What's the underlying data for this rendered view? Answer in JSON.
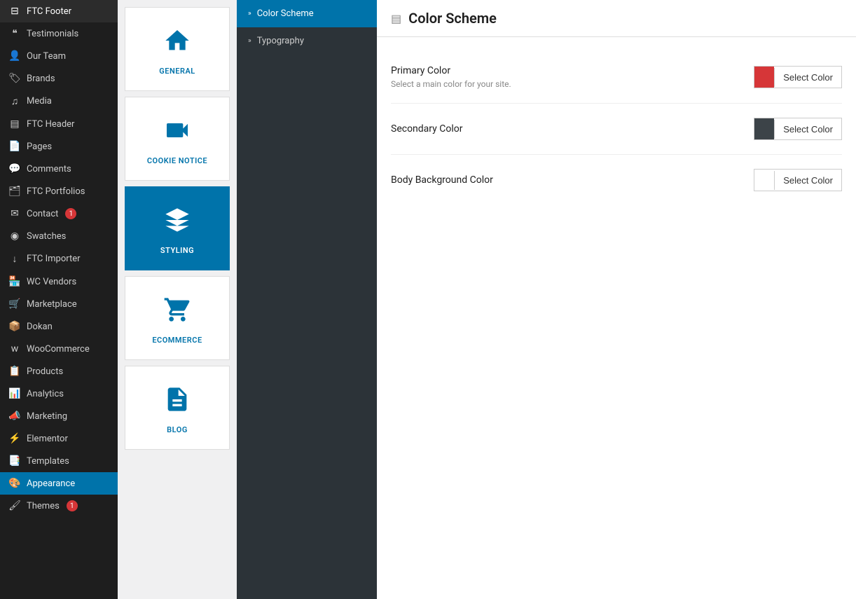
{
  "sidebar": {
    "items": [
      {
        "id": "ftc-footer",
        "label": "FTC Footer",
        "icon": "🔻",
        "active": false
      },
      {
        "id": "testimonials",
        "label": "Testimonials",
        "icon": "💬",
        "active": false
      },
      {
        "id": "our-team",
        "label": "Our Team",
        "icon": "👥",
        "active": false
      },
      {
        "id": "brands",
        "label": "Brands",
        "icon": "🏷",
        "active": false
      },
      {
        "id": "media",
        "label": "Media",
        "icon": "🎵",
        "active": false
      },
      {
        "id": "ftc-header",
        "label": "FTC Header",
        "icon": "📄",
        "active": false
      },
      {
        "id": "pages",
        "label": "Pages",
        "icon": "📃",
        "active": false
      },
      {
        "id": "comments",
        "label": "Comments",
        "icon": "💭",
        "active": false,
        "badge": null
      },
      {
        "id": "ftc-portfolios",
        "label": "FTC Portfolios",
        "icon": "🖼",
        "active": false
      },
      {
        "id": "contact",
        "label": "Contact",
        "icon": "✉",
        "active": false,
        "badge": "1"
      },
      {
        "id": "swatches",
        "label": "Swatches",
        "icon": "🎨",
        "active": false
      },
      {
        "id": "ftc-importer",
        "label": "FTC Importer",
        "icon": "⬇",
        "active": false
      },
      {
        "id": "wc-vendors",
        "label": "WC Vendors",
        "icon": "🏪",
        "active": false
      },
      {
        "id": "marketplace",
        "label": "Marketplace",
        "icon": "🛒",
        "active": false
      },
      {
        "id": "dokan",
        "label": "Dokan",
        "icon": "📦",
        "active": false
      },
      {
        "id": "woocommerce",
        "label": "WooCommerce",
        "icon": "🛍",
        "active": false
      },
      {
        "id": "products",
        "label": "Products",
        "icon": "📋",
        "active": false
      },
      {
        "id": "analytics",
        "label": "Analytics",
        "icon": "📊",
        "active": false
      },
      {
        "id": "marketing",
        "label": "Marketing",
        "icon": "📣",
        "active": false
      },
      {
        "id": "elementor",
        "label": "Elementor",
        "icon": "⚡",
        "active": false
      },
      {
        "id": "templates",
        "label": "Templates",
        "icon": "📑",
        "active": false
      },
      {
        "id": "appearance",
        "label": "Appearance",
        "icon": "🎨",
        "active": true
      },
      {
        "id": "themes",
        "label": "Themes",
        "icon": "🖌",
        "active": false,
        "badge": "1"
      }
    ]
  },
  "panels": [
    {
      "id": "general",
      "label": "GENERAL",
      "icon": "🏠",
      "active": false
    },
    {
      "id": "cookie-notice",
      "label": "COOKIE NOTICE",
      "icon": "🎥",
      "active": false
    },
    {
      "id": "styling",
      "label": "STYLING",
      "icon": "✳",
      "active": true
    },
    {
      "id": "ecommerce",
      "label": "ECOMMERCE",
      "icon": "🛒",
      "active": false
    },
    {
      "id": "blog",
      "label": "BLOG",
      "icon": "📄",
      "active": false
    }
  ],
  "submenu": {
    "items": [
      {
        "id": "color-scheme",
        "label": "Color Scheme",
        "active": true
      },
      {
        "id": "typography",
        "label": "Typography",
        "active": false
      }
    ]
  },
  "settings": {
    "title": "Color Scheme",
    "colors": [
      {
        "id": "primary",
        "label": "Primary Color",
        "desc": "Select a main color for your site.",
        "swatch": "#d63638",
        "button_label": "Select Color"
      },
      {
        "id": "secondary",
        "label": "Secondary Color",
        "desc": "",
        "swatch": "#3c4348",
        "button_label": "Select Color"
      },
      {
        "id": "body-bg",
        "label": "Body Background Color",
        "desc": "",
        "swatch": "#ffffff",
        "button_label": "Select Color"
      }
    ]
  }
}
